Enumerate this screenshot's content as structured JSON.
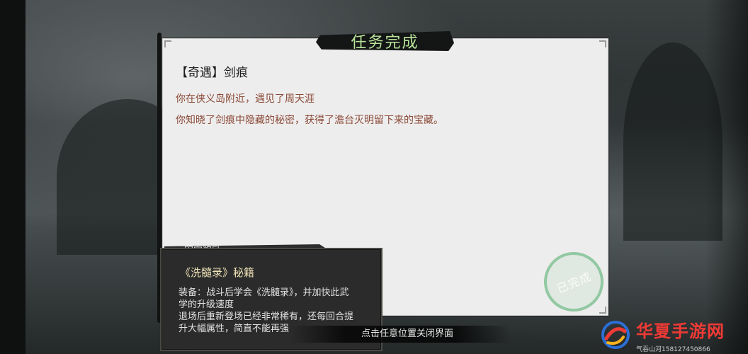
{
  "quest_window": {
    "header": "任务完成",
    "title": "【奇遇】剑痕",
    "lines": [
      "你在侠义岛附近，遇见了周天涯",
      "你知晓了剑痕中隐藏的秘密，获得了澹台灭明留下来的宝藏。"
    ],
    "stamp_text": "已完成"
  },
  "reward_strip": {
    "label": "固定奖励"
  },
  "item_tooltip": {
    "name": "《洗髓录》秘籍",
    "description_lines": [
      "装备：战斗后学会《洗髓录》，并加快此武",
      "学的升级速度",
      "退场后重新登场已经非常稀有，还每回合提",
      "升大幅属性，简直不能再强"
    ]
  },
  "hint": {
    "text": "点击任意位置关闭界面"
  },
  "watermark": {
    "brand": "华夏手游网",
    "sub": "气吞山河158127450866"
  },
  "colors": {
    "header_text": "#b8e39a",
    "quest_line": "#8a4a38",
    "stamp": "#78be8c",
    "watermark": "#f03a35"
  },
  "icons": [
    "swirl-logo-icon"
  ]
}
